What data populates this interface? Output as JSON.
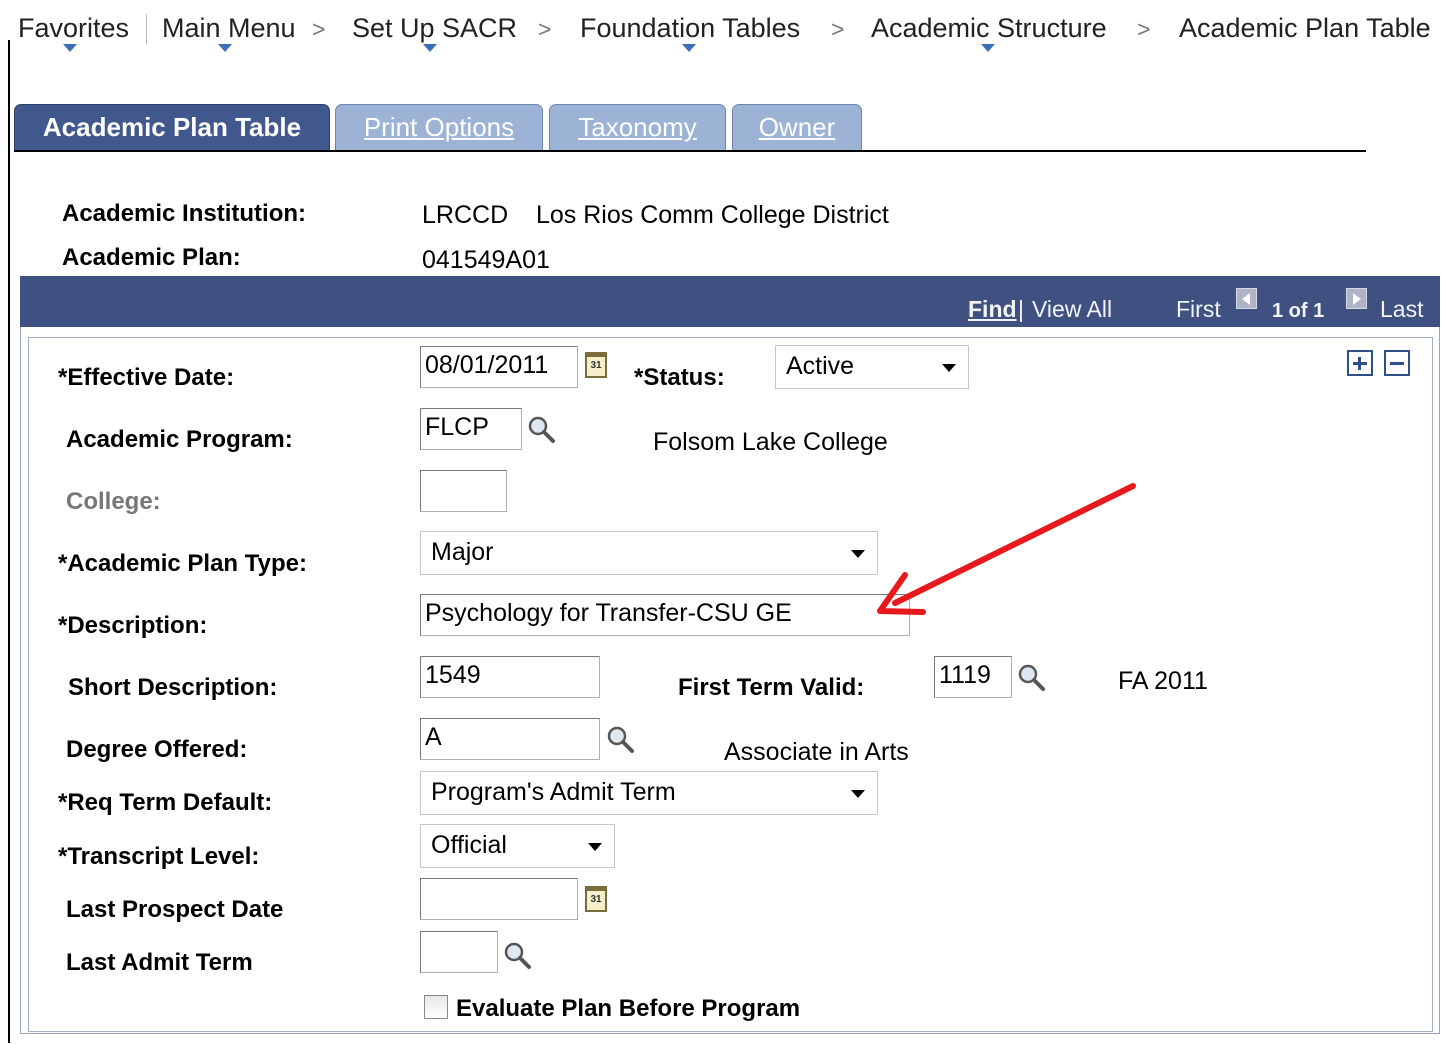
{
  "breadcrumb": {
    "items": [
      "Favorites",
      "Main Menu",
      "Set Up SACR",
      "Foundation Tables",
      "Academic Structure",
      "Academic Plan Table"
    ],
    "separator": ">"
  },
  "tabs": [
    {
      "label": "Academic Plan Table",
      "active": true
    },
    {
      "label": "Print Options",
      "active": false
    },
    {
      "label": "Taxonomy",
      "active": false
    },
    {
      "label": "Owner",
      "active": false
    }
  ],
  "header": {
    "institution_label": "Academic Institution:",
    "institution_code": "LRCCD",
    "institution_name": "Los Rios Comm College District",
    "plan_label": "Academic Plan:",
    "plan_value": "041549A01"
  },
  "group_nav": {
    "find": "Find",
    "divider": "|",
    "view_all": "View All",
    "first": "First",
    "counter": "1 of 1",
    "last": "Last"
  },
  "form": {
    "effective_date": {
      "label": "*Effective Date:",
      "value": "08/01/2011"
    },
    "status": {
      "label": "*Status:",
      "value": "Active"
    },
    "academic_program": {
      "label": "Academic Program:",
      "value": "FLCP",
      "description": "Folsom Lake College"
    },
    "college": {
      "label": "College:",
      "value": ""
    },
    "plan_type": {
      "label": "*Academic Plan Type:",
      "value": "Major"
    },
    "description": {
      "label": "*Description:",
      "value": "Psychology for Transfer-CSU GE"
    },
    "short_description": {
      "label": "Short Description:",
      "value": "1549"
    },
    "first_term_valid": {
      "label": "First Term Valid:",
      "value": "1119",
      "description": "FA 2011"
    },
    "degree_offered": {
      "label": "Degree Offered:",
      "value": "A",
      "description": "Associate in Arts"
    },
    "req_term_default": {
      "label": "*Req Term Default:",
      "value": "Program's Admit Term"
    },
    "transcript_level": {
      "label": "*Transcript Level:",
      "value": "Official"
    },
    "last_prospect_date": {
      "label": "Last Prospect Date",
      "value": ""
    },
    "last_admit_term": {
      "label": "Last Admit Term",
      "value": ""
    },
    "evaluate_plan": {
      "label": "Evaluate Plan Before Program",
      "checked": false
    }
  },
  "colors": {
    "tab_active": "#41588e",
    "tab_inactive": "#9cb3d6",
    "group_header": "#3f5181",
    "annotation_arrow": "#e8191c"
  },
  "icons": [
    "calendar-icon",
    "lookup-icon",
    "add-row-icon",
    "delete-row-icon",
    "prev-arrow-icon",
    "next-arrow-icon",
    "dropdown-caret-icon"
  ]
}
